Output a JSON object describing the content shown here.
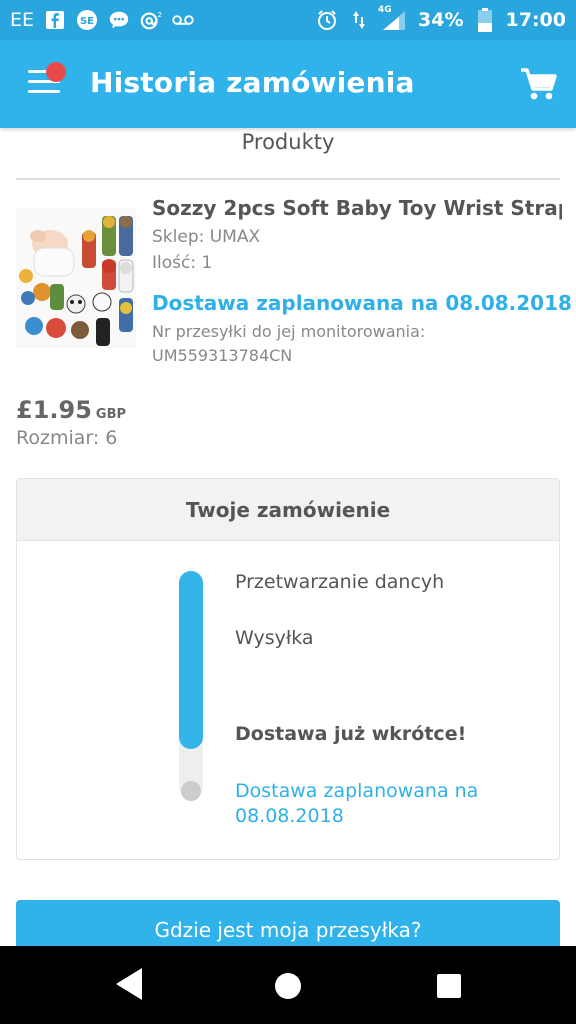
{
  "status_bar": {
    "carrier": "EE",
    "icons_left": [
      "facebook-icon",
      "sf-app-icon",
      "chat-bubble-icon",
      "at-sign-icon",
      "voicemail-icon"
    ],
    "network": "4G",
    "battery": "34%",
    "time": "17:00",
    "icons_right": [
      "alarm-icon",
      "data-arrows-icon",
      "signal-icon",
      "battery-icon"
    ]
  },
  "app_bar": {
    "title": "Historia zamówienia",
    "menu_icon": "hamburger-menu-icon",
    "notification_dot_color": "#e94b4b",
    "cart_icon": "shopping-cart-icon"
  },
  "products": {
    "section_title": "Produkty",
    "item": {
      "name": "Sozzy 2pcs Soft Baby Toy Wrist Strap ...",
      "shop": "Sklep: UMAX",
      "quantity": "Ilość: 1",
      "delivery": "Dostawa zaplanowana na 08.08.2018",
      "tracking_label": "Nr przesyłki do jej monitorowania:",
      "tracking_number": "UM559313784CN",
      "price": "£1.95",
      "currency": "GBP",
      "size": "Rozmiar: 6"
    }
  },
  "order": {
    "title": "Twoje zamówienie",
    "steps": [
      "Przetwarzanie dancyh",
      "Wysyłka",
      "Dostawa już wkrótce!",
      "Dostawa zaplanowana na 08.08.2018"
    ],
    "progress_fraction": 0.78
  },
  "actions": {
    "track_button": "Gdzie jest moja przesyłka?"
  },
  "colors": {
    "brand_blue": "#30b2ea",
    "status_bar": "#2aa6de",
    "link_blue": "#2fb0e8"
  }
}
